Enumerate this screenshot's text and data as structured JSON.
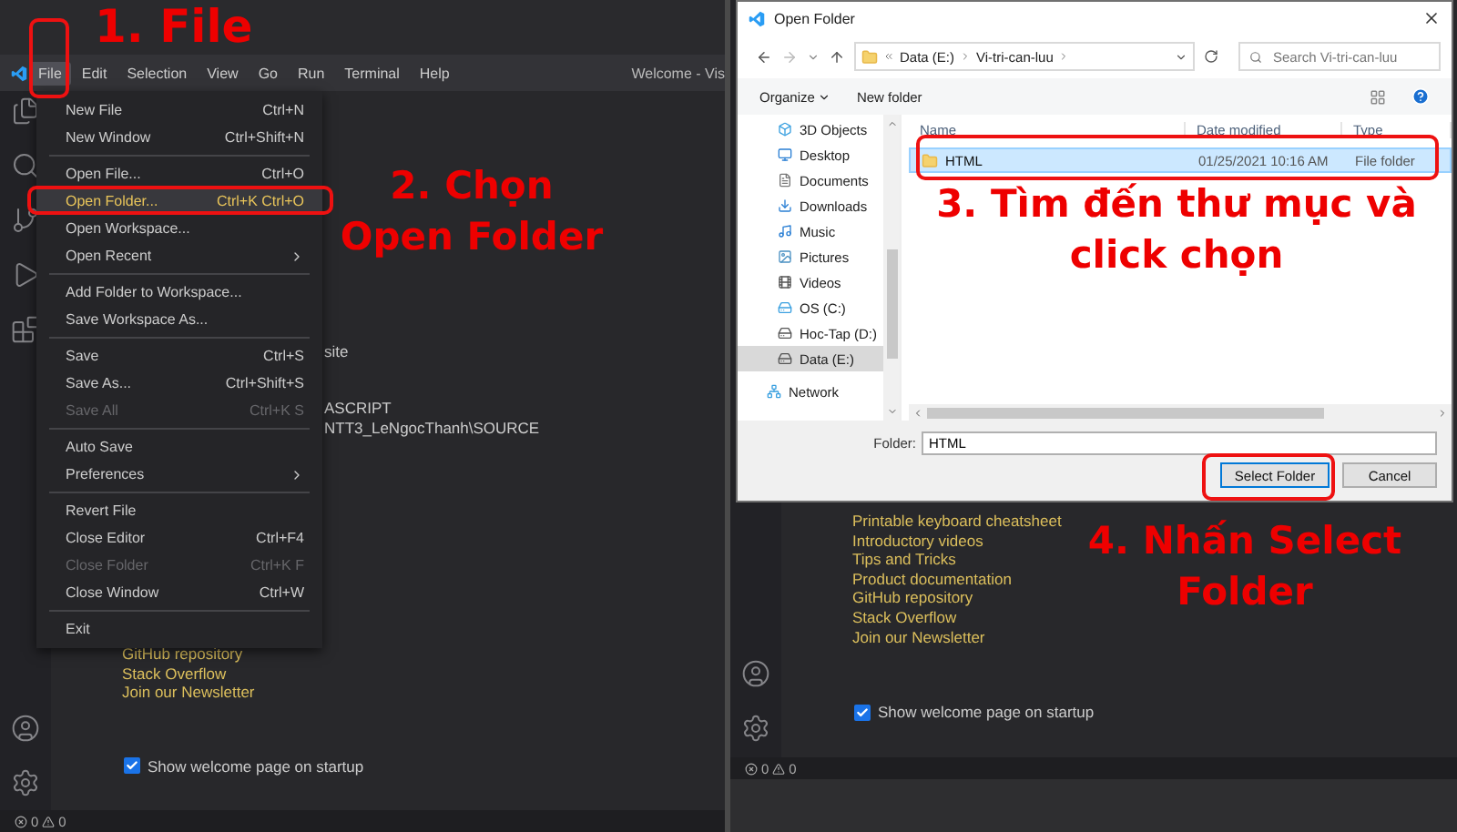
{
  "left_panel": {
    "step_label": "1. File",
    "step_note": "2. Chọn Open Folder",
    "menu_bar": {
      "items": [
        {
          "label": "File",
          "selected": true
        },
        {
          "label": "Edit",
          "selected": false
        },
        {
          "label": "Selection",
          "selected": false
        },
        {
          "label": "View",
          "selected": false
        },
        {
          "label": "Go",
          "selected": false
        },
        {
          "label": "Run",
          "selected": false
        },
        {
          "label": "Terminal",
          "selected": false
        },
        {
          "label": "Help",
          "selected": false
        }
      ],
      "window_title": "Welcome - Vis"
    },
    "file_menu": {
      "groups": [
        [
          {
            "label": "New File",
            "shortcut": "Ctrl+N",
            "selected": false,
            "disabled": false,
            "submenu": false
          },
          {
            "label": "New Window",
            "shortcut": "Ctrl+Shift+N",
            "selected": false,
            "disabled": false,
            "submenu": false
          }
        ],
        [
          {
            "label": "Open File...",
            "shortcut": "Ctrl+O",
            "selected": false,
            "disabled": false,
            "submenu": false
          },
          {
            "label": "Open Folder...",
            "shortcut": "Ctrl+K Ctrl+O",
            "selected": true,
            "disabled": false,
            "submenu": false
          },
          {
            "label": "Open Workspace...",
            "selected": false,
            "disabled": false,
            "submenu": false
          },
          {
            "label": "Open Recent",
            "selected": false,
            "disabled": false,
            "submenu": true
          }
        ],
        [
          {
            "label": "Add Folder to Workspace...",
            "selected": false,
            "disabled": false,
            "submenu": false
          },
          {
            "label": "Save Workspace As...",
            "selected": false,
            "disabled": false,
            "submenu": false
          }
        ],
        [
          {
            "label": "Save",
            "shortcut": "Ctrl+S",
            "selected": false,
            "disabled": false,
            "submenu": false
          },
          {
            "label": "Save As...",
            "shortcut": "Ctrl+Shift+S",
            "selected": false,
            "disabled": false,
            "submenu": false
          },
          {
            "label": "Save All",
            "shortcut": "Ctrl+K S",
            "selected": false,
            "disabled": true,
            "submenu": false
          }
        ],
        [
          {
            "label": "Auto Save",
            "selected": false,
            "disabled": false,
            "submenu": false
          },
          {
            "label": "Preferences",
            "selected": false,
            "disabled": false,
            "submenu": true
          }
        ],
        [
          {
            "label": "Revert File",
            "selected": false,
            "disabled": false,
            "submenu": false
          },
          {
            "label": "Close Editor",
            "shortcut": "Ctrl+F4",
            "selected": false,
            "disabled": false,
            "submenu": false
          },
          {
            "label": "Close Folder",
            "shortcut": "Ctrl+K F",
            "selected": false,
            "disabled": true,
            "submenu": false
          },
          {
            "label": "Close Window",
            "shortcut": "Ctrl+W",
            "selected": false,
            "disabled": false,
            "submenu": false
          }
        ],
        [
          {
            "label": "Exit",
            "selected": false,
            "disabled": false,
            "submenu": false
          }
        ]
      ]
    },
    "editor": {
      "partial_lines": [
        "site",
        "ASCRIPT",
        "NTT3_LeNgocThanh\\SOURCE"
      ],
      "links": [
        "GitHub repository",
        "Stack Overflow",
        "Join our Newsletter"
      ],
      "startup_checkbox": {
        "label": "Show welcome page on startup",
        "checked": true
      }
    },
    "status_bar": {
      "errors": "0",
      "warnings": "0"
    }
  },
  "right_panel": {
    "step_note_find": "3. Tìm đến thư mục và click chọn",
    "step_note_select": "4. Nhấn Select Folder",
    "dialog": {
      "title": "Open Folder",
      "breadcrumb": [
        "Data (E:)",
        "Vi-tri-can-luu"
      ],
      "search": {
        "placeholder": "Search Vi-tri-can-luu"
      },
      "toolbar": {
        "organize": "Organize",
        "new_folder": "New folder"
      },
      "sidebar": [
        {
          "label": "3D Objects",
          "kind": "objects",
          "selected": false
        },
        {
          "label": "Desktop",
          "kind": "desktop",
          "selected": false
        },
        {
          "label": "Documents",
          "kind": "documents",
          "selected": false
        },
        {
          "label": "Downloads",
          "kind": "downloads",
          "selected": false
        },
        {
          "label": "Music",
          "kind": "music",
          "selected": false
        },
        {
          "label": "Pictures",
          "kind": "pictures",
          "selected": false
        },
        {
          "label": "Videos",
          "kind": "videos",
          "selected": false
        },
        {
          "label": "OS (C:)",
          "kind": "system_drive",
          "selected": false
        },
        {
          "label": "Hoc-Tap (D:)",
          "kind": "drive",
          "selected": false
        },
        {
          "label": "Data (E:)",
          "kind": "drive",
          "selected": true
        },
        {
          "label": "Network",
          "kind": "network",
          "selected": false
        }
      ],
      "columns": [
        "Name",
        "Date modified",
        "Type"
      ],
      "rows": [
        {
          "name": "HTML",
          "date": "01/25/2021 10:16 AM",
          "type": "File folder",
          "selected": true
        }
      ],
      "folder_field": {
        "label": "Folder:",
        "value": "HTML"
      },
      "buttons": [
        "Select Folder",
        "Cancel"
      ]
    },
    "editor": {
      "links": [
        "Printable keyboard cheatsheet",
        "Introductory videos",
        "Tips and Tricks",
        "Product documentation",
        "GitHub repository",
        "Stack Overflow",
        "Join our Newsletter"
      ],
      "startup_checkbox": {
        "label": "Show welcome page on startup",
        "checked": true
      }
    },
    "status_bar": {
      "errors": "0",
      "warnings": "0"
    }
  }
}
